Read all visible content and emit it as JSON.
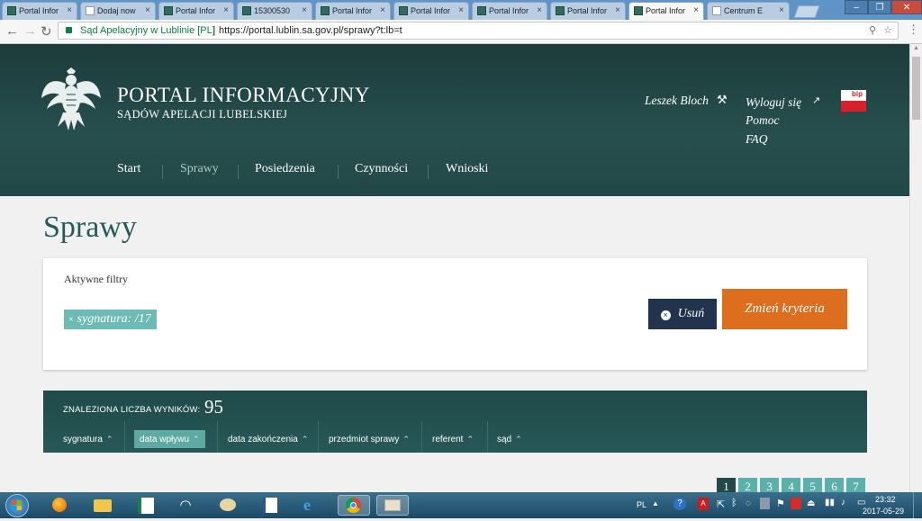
{
  "browser": {
    "tabs": [
      {
        "label": "Portal Infor"
      },
      {
        "label": "Dodaj now"
      },
      {
        "label": "Portal Infor"
      },
      {
        "label": "15300530"
      },
      {
        "label": "Portal Infor"
      },
      {
        "label": "Portal Infor"
      },
      {
        "label": "Portal Infor"
      },
      {
        "label": "Portal Infor"
      },
      {
        "label": "Portal Infor"
      },
      {
        "label": "Centrum E"
      }
    ],
    "active_tab": 8,
    "secure_label": "Sąd Apelacyjny w Lublinie [PL]",
    "url": "https://portal.lublin.sa.gov.pl/sprawy?t:lb=t"
  },
  "header": {
    "title": "PORTAL INFORMACYJNY",
    "subtitle": "SĄDÓW APELACJI LUBELSKIEJ",
    "user_name": "Leszek Bloch",
    "logout": "Wyloguj się",
    "help": "Pomoc",
    "faq": "FAQ",
    "bip": "bip"
  },
  "nav": [
    {
      "label": "Start"
    },
    {
      "label": "Sprawy"
    },
    {
      "label": "Posiedzenia"
    },
    {
      "label": "Czynności"
    },
    {
      "label": "Wnioski"
    }
  ],
  "page": {
    "title": "Sprawy",
    "active_filters_label": "Aktywne filtry",
    "filter_chip": "sygnatura: /17",
    "remove_label": "Usuń",
    "change_label": "Zmień kryteria"
  },
  "results": {
    "label": "ZNALEZIONA LICZBA WYNIKÓW:",
    "count": "95",
    "columns": [
      {
        "label": "sygnatura"
      },
      {
        "label": "data wpływu"
      },
      {
        "label": "data zakończenia"
      },
      {
        "label": "przedmiot sprawy"
      },
      {
        "label": "referent"
      },
      {
        "label": "sąd"
      }
    ],
    "sort_arrow": "≈"
  },
  "pagination": [
    "1",
    "2",
    "3",
    "4",
    "5",
    "6",
    "7"
  ],
  "taskbar": {
    "lang": "PL",
    "time": "23:32",
    "date": "2017-05-29"
  },
  "colors": {
    "header_bg": "#1b3c3b",
    "accent_teal": "#5bb0ab",
    "orange": "#dd6e1e",
    "navy": "#22334d"
  }
}
